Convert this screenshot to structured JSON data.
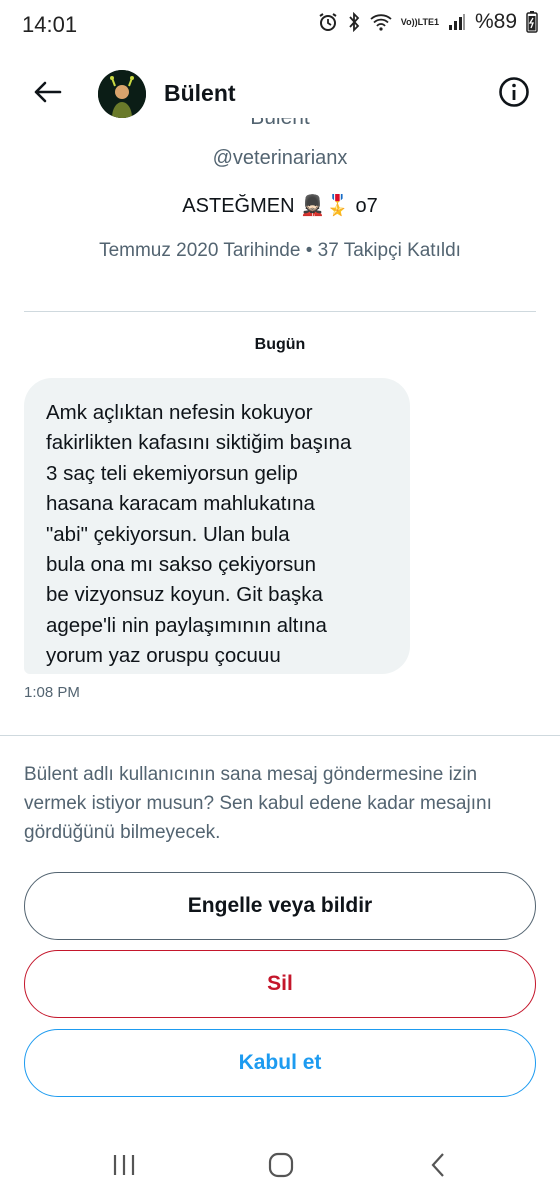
{
  "status_bar": {
    "time": "14:01",
    "battery": "%89",
    "network": "LTE1",
    "volte": "Vo))",
    "icons": [
      "alarm-icon",
      "bluetooth-icon",
      "wifi-icon",
      "signal-icon",
      "battery-icon"
    ]
  },
  "header": {
    "name": "Bülent",
    "back_icon": "arrow-left-icon",
    "info_icon": "info-icon"
  },
  "profile": {
    "name_cut": "Bülent",
    "handle": "@veterinarianx",
    "bio": "ASTEĞMEN 💂🏻🎖️ o7",
    "meta": "Temmuz 2020 Tarihinde • 37 Takipçi Katıldı"
  },
  "conversation": {
    "day_label": "Bugün",
    "message": {
      "text": "Amk açlıktan nefesin kokuyor\nfakirlikten kafasını siktiğim başına\n3 saç teli ekemiyorsun gelip\nhasana karacam mahlukatına\n\"abi\" çekiyorsun. Ulan bula\nbula ona mı sakso çekiyorsun\nbe vizyonsuz koyun. Git başka\nagepe'li nin paylaşımının altına\nyorum yaz oruspu çocuuu",
      "time": "1:08 PM"
    }
  },
  "request": {
    "text": "Bülent adlı kullanıcının sana mesaj göndermesine izin vermek istiyor musun? Sen kabul edene kadar mesajını gördüğünü bilmeyecek.",
    "block_label": "Engelle veya bildir",
    "delete_label": "Sil",
    "accept_label": "Kabul et"
  },
  "colors": {
    "accent": "#1d9bf0",
    "danger": "#c4162b",
    "muted": "#536471",
    "bubble": "#eff3f4"
  }
}
